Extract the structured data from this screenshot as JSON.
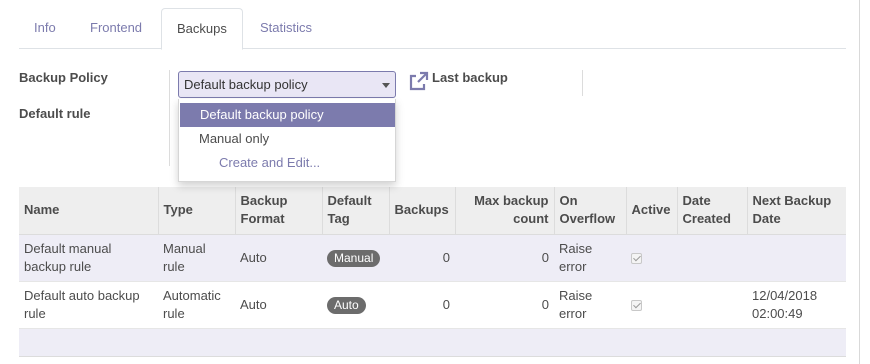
{
  "tabs": [
    "Info",
    "Frontend",
    "Backups",
    "Statistics"
  ],
  "form": {
    "backup_policy_label": "Backup Policy",
    "default_rule_label": "Default rule",
    "backup_policy_value": "Default backup policy",
    "last_backup_label": "Last backup",
    "external_link_icon": "external-link-icon"
  },
  "dropdown": {
    "options": [
      "Default backup policy",
      "Manual only"
    ],
    "create_label": "Create and Edit..."
  },
  "table": {
    "headers": {
      "name": "Name",
      "type": "Type",
      "format_1": "Backup",
      "format_2": "Format",
      "tag_1": "Default",
      "tag_2": "Tag",
      "backups": "Backups",
      "max_1": "Max backup",
      "max_2": "count",
      "overflow_1": "On",
      "overflow_2": "Overflow",
      "active": "Active",
      "date_1": "Date",
      "date_2": "Created",
      "next_1": "Next Backup",
      "next_2": "Date"
    },
    "rows": [
      {
        "name_1": "Default manual",
        "name_2": "backup rule",
        "type_1": "Manual",
        "type_2": "rule",
        "format": "Auto",
        "tag": "Manual",
        "backups": "0",
        "max_count": "0",
        "overflow_1": "Raise",
        "overflow_2": "error",
        "active": true,
        "date_created": "",
        "next_1": "",
        "next_2": ""
      },
      {
        "name_1": "Default auto backup",
        "name_2": "rule",
        "type_1": "Automatic",
        "type_2": "rule",
        "format": "Auto",
        "tag": "Auto",
        "backups": "0",
        "max_count": "0",
        "overflow_1": "Raise",
        "overflow_2": "error",
        "active": true,
        "date_created": "",
        "next_1": "12/04/2018",
        "next_2": "02:00:49"
      }
    ]
  },
  "colors": {
    "accent": "#7c7bad",
    "selected_bg": "#e9e6f5",
    "badge": "#6c6c6c"
  }
}
